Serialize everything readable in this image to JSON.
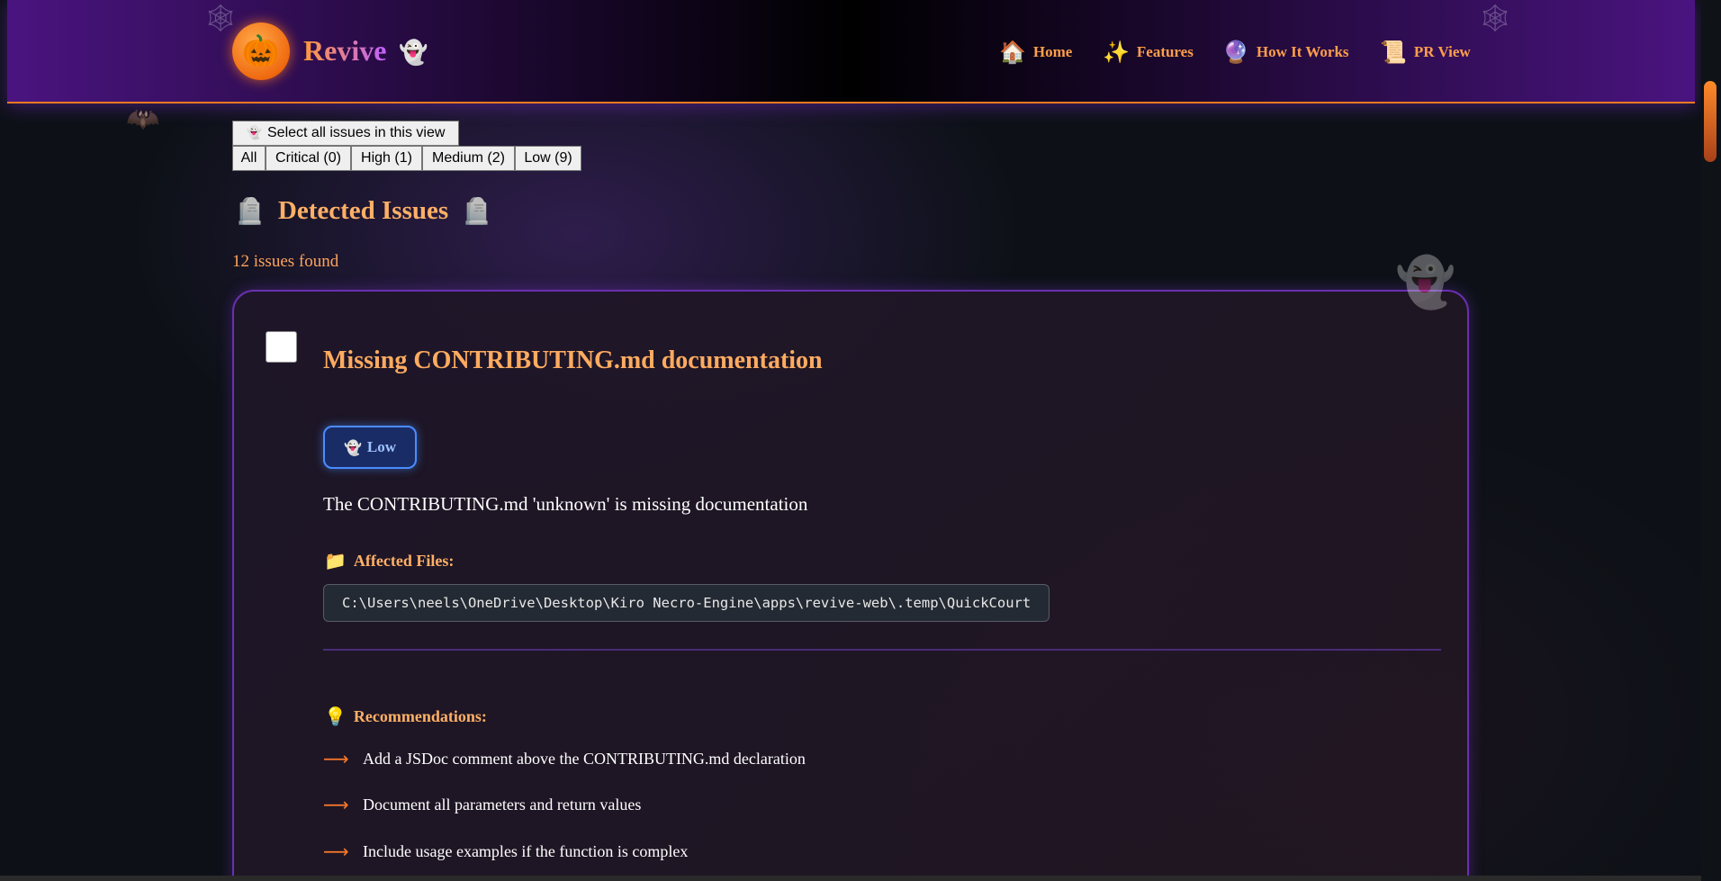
{
  "header": {
    "brand": "Revive",
    "nav": [
      {
        "icon": "🏠",
        "label": "Home"
      },
      {
        "icon": "✨",
        "label": "Features"
      },
      {
        "icon": "🔮",
        "label": "How It Works"
      },
      {
        "icon": "📜",
        "label": "PR View"
      }
    ]
  },
  "controls": {
    "select_all_icon": "👻",
    "select_all_label": "Select all issues in this view",
    "filters": [
      "All",
      "Critical (0)",
      "High (1)",
      "Medium (2)",
      "Low (9)"
    ]
  },
  "section": {
    "title": "Detected Issues",
    "count_text": "12 issues found"
  },
  "issue": {
    "title": "Missing CONTRIBUTING.md documentation",
    "severity": "Low",
    "description": "The CONTRIBUTING.md 'unknown' is missing documentation",
    "affected_files_label": "Affected Files:",
    "file_path": "C:\\Users\\neels\\OneDrive\\Desktop\\Kiro Necro-Engine\\apps\\revive-web\\.temp\\QuickCourt",
    "recommendations_label": "Recommendations:",
    "recommendations": [
      "Add a JSDoc comment above the CONTRIBUTING.md declaration",
      "Document all parameters and return values",
      "Include usage examples if the function is complex"
    ]
  },
  "colors": {
    "accent_orange": "#ff9f4a",
    "low_badge_border": "#4a8cff",
    "card_border": "#6a2fb0"
  }
}
